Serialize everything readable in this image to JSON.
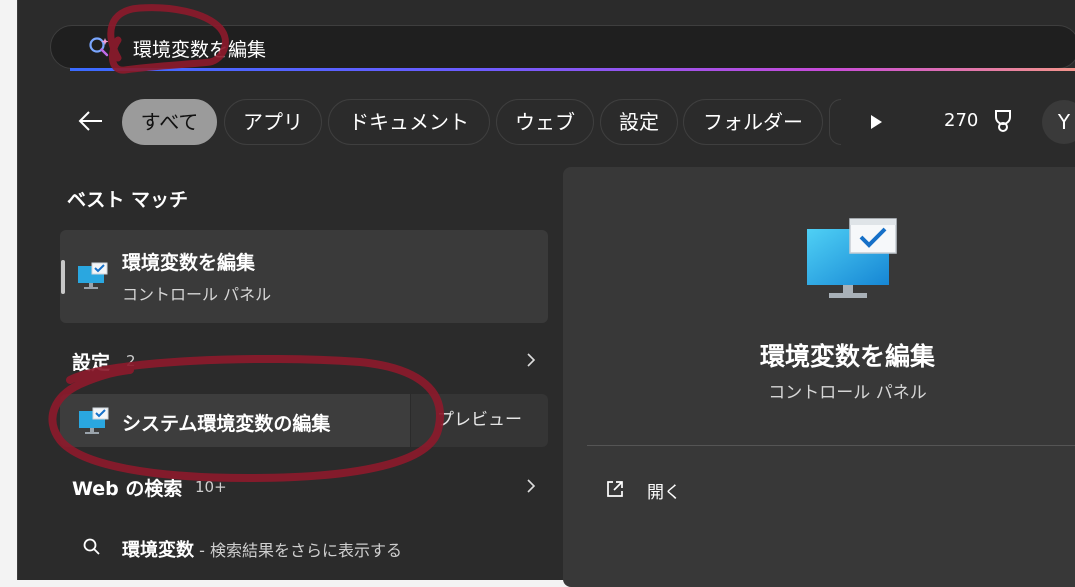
{
  "search": {
    "query": "環境変数を編集"
  },
  "filters": {
    "items": [
      "すべて",
      "アプリ",
      "ドキュメント",
      "ウェブ",
      "設定",
      "フォルダー"
    ],
    "points": "270",
    "avatar_letter": "Y"
  },
  "best_match": {
    "heading": "ベスト マッチ",
    "title": "環境変数を編集",
    "subtitle": "コントロール パネル"
  },
  "settings_section": {
    "heading": "設定",
    "count": "2",
    "item_label": "システム環境変数の編集",
    "preview_label": "プレビュー"
  },
  "web_section": {
    "heading": "Web の検索",
    "count": "10+",
    "query": "環境変数",
    "suggestion": " - 検索結果をさらに表示する"
  },
  "detail": {
    "title": "環境変数を編集",
    "subtitle": "コントロール パネル",
    "open_label": "開く"
  },
  "colors": {
    "annotation": "#8b1a2b",
    "accent_chip": "#9b9b9b"
  }
}
